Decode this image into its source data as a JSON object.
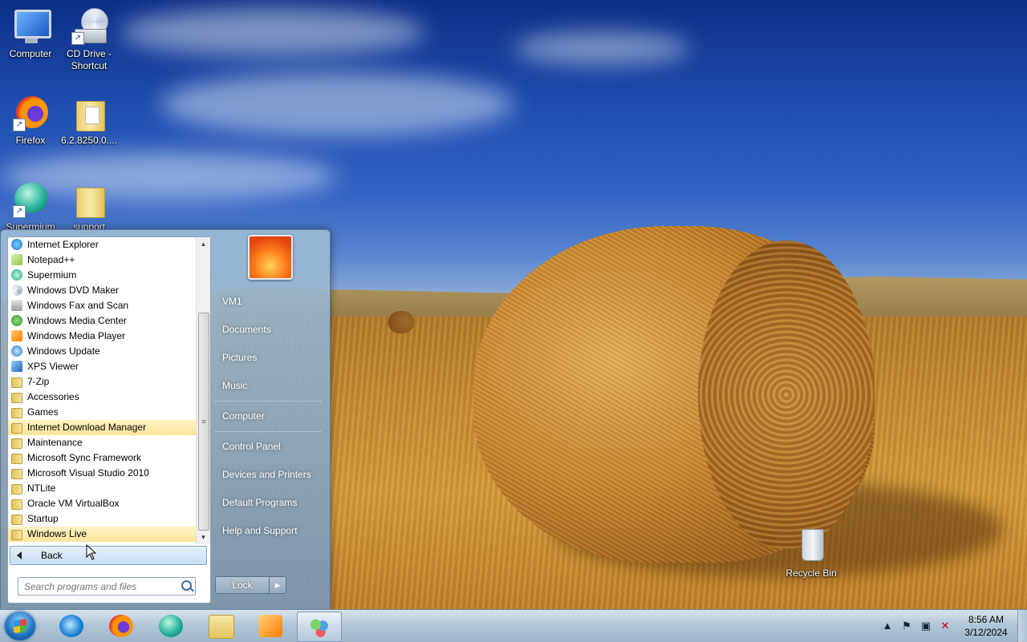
{
  "desktop": {
    "icons": [
      {
        "label": "Computer"
      },
      {
        "label": "CD Drive -\nShortcut"
      },
      {
        "label": "Firefox"
      },
      {
        "label": "6.2.8250.0...."
      },
      {
        "label": "Supermium"
      },
      {
        "label": "support"
      },
      {
        "label": "Recycle Bin"
      }
    ]
  },
  "start_menu": {
    "programs": [
      {
        "label": "Internet Explorer",
        "icon": "ie-icon"
      },
      {
        "label": "Notepad++",
        "icon": "notepad-icon"
      },
      {
        "label": "Supermium",
        "icon": "supermium-icon"
      },
      {
        "label": "Windows DVD Maker",
        "icon": "dvd-maker-icon"
      },
      {
        "label": "Windows Fax and Scan",
        "icon": "fax-icon"
      },
      {
        "label": "Windows Media Center",
        "icon": "media-center-icon"
      },
      {
        "label": "Windows Media Player",
        "icon": "media-player-icon"
      },
      {
        "label": "Windows Update",
        "icon": "update-icon"
      },
      {
        "label": "XPS Viewer",
        "icon": "xps-icon"
      },
      {
        "label": "7-Zip",
        "icon": "folder-icon"
      },
      {
        "label": "Accessories",
        "icon": "folder-icon"
      },
      {
        "label": "Games",
        "icon": "folder-icon"
      },
      {
        "label": "Internet Download Manager",
        "icon": "folder-icon",
        "highlighted": true
      },
      {
        "label": "Maintenance",
        "icon": "folder-icon"
      },
      {
        "label": "Microsoft Sync Framework",
        "icon": "folder-icon"
      },
      {
        "label": "Microsoft Visual Studio 2010",
        "icon": "folder-icon"
      },
      {
        "label": "NTLite",
        "icon": "folder-icon"
      },
      {
        "label": "Oracle VM VirtualBox",
        "icon": "folder-icon"
      },
      {
        "label": "Startup",
        "icon": "folder-icon"
      },
      {
        "label": "Windows Live",
        "icon": "folder-icon",
        "highlighted": true
      }
    ],
    "back_label": "Back",
    "search_placeholder": "Search programs and files",
    "right_items": [
      "VM1",
      "Documents",
      "Pictures",
      "Music",
      "Computer",
      "Control Panel",
      "Devices and Printers",
      "Default Programs",
      "Help and Support"
    ],
    "lock_label": "Lock"
  },
  "taskbar": {
    "pinned": [
      "internet-explorer",
      "firefox",
      "supermium",
      "windows-explorer",
      "media-player",
      "control-panel-users"
    ],
    "clock_time": "8:56 AM",
    "clock_date": "3/12/2024"
  },
  "colors": {
    "highlight": "#fbe59a",
    "taskbar": "#aec4d6"
  }
}
